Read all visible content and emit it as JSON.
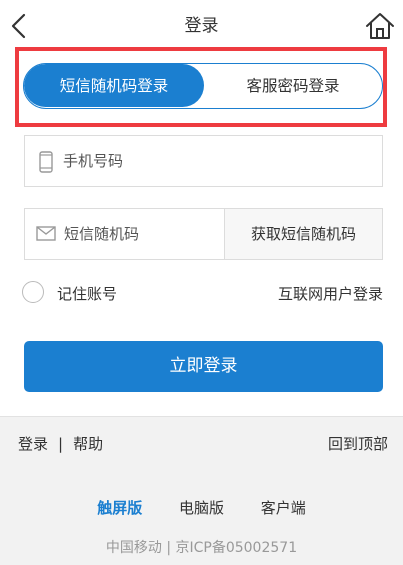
{
  "header": {
    "title": "登录"
  },
  "tabs": [
    {
      "label": "短信随机码登录",
      "active": true
    },
    {
      "label": "客服密码登录",
      "active": false
    }
  ],
  "form": {
    "phone_placeholder": "手机号码",
    "sms_placeholder": "短信随机码",
    "get_code_label": "获取短信随机码",
    "remember_label": "记住账号",
    "internet_login_label": "互联网用户登录",
    "submit_label": "立即登录"
  },
  "footer": {
    "login_link": "登录",
    "separator": "|",
    "help_link": "帮助",
    "back_to_top": "回到顶部",
    "versions": [
      {
        "label": "触屏版",
        "active": true
      },
      {
        "label": "电脑版",
        "active": false
      },
      {
        "label": "客户端",
        "active": false
      }
    ],
    "icp_text": "中国移动 | 京ICP备05002571"
  },
  "colors": {
    "accent": "#1b7fd0",
    "highlight": "#ee3b40",
    "footer_bg": "#f2f2f2"
  },
  "icons": [
    "back-icon",
    "home-icon",
    "phone-icon",
    "mail-icon"
  ]
}
